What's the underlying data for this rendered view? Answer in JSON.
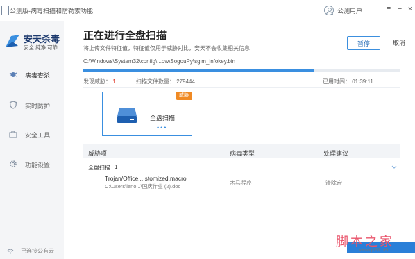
{
  "window": {
    "title": "公测版-病毒扫描和防勒索功能",
    "user_label": "公测用户"
  },
  "sidebar": {
    "brand_name": "安天杀毒",
    "brand_slogan": "安全 纯净 可靠",
    "items": [
      {
        "label": "病毒查杀",
        "icon": "bug-icon",
        "active": true
      },
      {
        "label": "实时防护",
        "icon": "shield-icon",
        "active": false
      },
      {
        "label": "安全工具",
        "icon": "toolbox-icon",
        "active": false
      },
      {
        "label": "功能设置",
        "icon": "gear-icon",
        "active": false
      }
    ],
    "status_text": "已连接公有云"
  },
  "scan": {
    "heading": "正在进行全盘扫描",
    "subtext": "将上传文件特征值，特征值仅用于威胁对比，安天不会收集相关信息",
    "pause_label": "暂停",
    "cancel_label": "取消",
    "current_path": "C:\\Windows\\System32\\config\\...ow\\SogouPy\\sgim_infokey.bin",
    "progress_fraction": 0.73,
    "threats_label": "发现威胁：",
    "threats_count": "1",
    "files_label": "扫描文件数量：",
    "files_count": "279444",
    "elapsed_label": "已用时间：",
    "elapsed_time": "01:39:11"
  },
  "card": {
    "badge": "威胁",
    "label": "全盘扫描",
    "dots": "•••"
  },
  "table": {
    "headers": [
      "威胁项",
      "病毒类型",
      "处理建议"
    ],
    "group": {
      "label": "全盘扫描",
      "count": "1"
    },
    "rows": [
      {
        "name": "Trojan/Office....stomized.macro",
        "path": "C:\\Users\\leno...\\国庆作业 (2).doc",
        "type": "木马程序",
        "action": "清除宏"
      }
    ]
  },
  "watermark": {
    "text": "脚本之家",
    "sub": "www.jb51.net"
  },
  "colors": {
    "accent": "#3a8fe0",
    "threat_red": "#e03a2a",
    "badge_orange": "#f08a24",
    "sidebar_bg": "#f4f5f7"
  }
}
